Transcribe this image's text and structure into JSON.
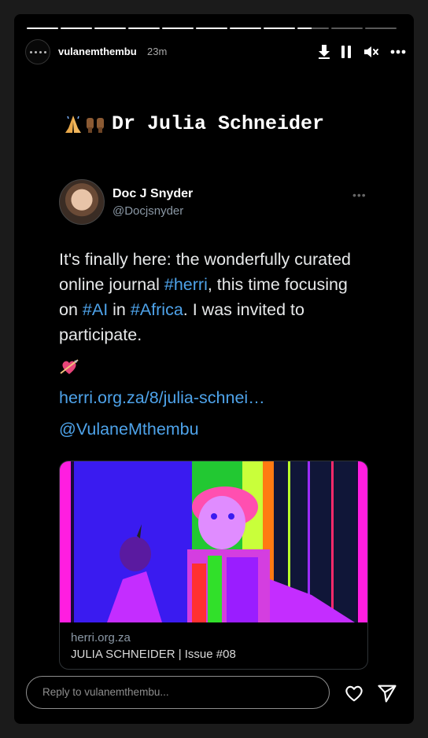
{
  "story": {
    "progress_segments": 11,
    "progress_current_index": 8,
    "progress_current_fraction": 0.45,
    "username": "vulanemthembu",
    "time": "23m",
    "header_icons": [
      "download-icon",
      "pause-icon",
      "mute-icon",
      "more-icon"
    ],
    "title_emojis": [
      "folded-hands-icon",
      "raised-hands-icon"
    ],
    "title": "Dr Julia Schneider"
  },
  "tweet": {
    "name": "Doc J Snyder",
    "handle": "@Docjsnyder",
    "text_1": "It's finally here: the wonderfully curated online journal ",
    "tag_herri": "#herri",
    "text_2": ", this time focusing on ",
    "tag_ai": "#AI",
    "text_3": " in ",
    "tag_africa": "#Africa",
    "text_4": ". I was invited to participate.",
    "emoji": "heart-with-arrow-icon",
    "link": "herri.org.za/8/julia-schnei…",
    "mention": "@VulaneMthembu",
    "card": {
      "domain": "herri.org.za",
      "title": "JULIA SCHNEIDER | Issue #08"
    }
  },
  "reply": {
    "placeholder": "Reply to vulanemthembu..."
  },
  "colors": {
    "background": "#000000",
    "link": "#4ea3ea",
    "secondary": "#8b98a5"
  }
}
